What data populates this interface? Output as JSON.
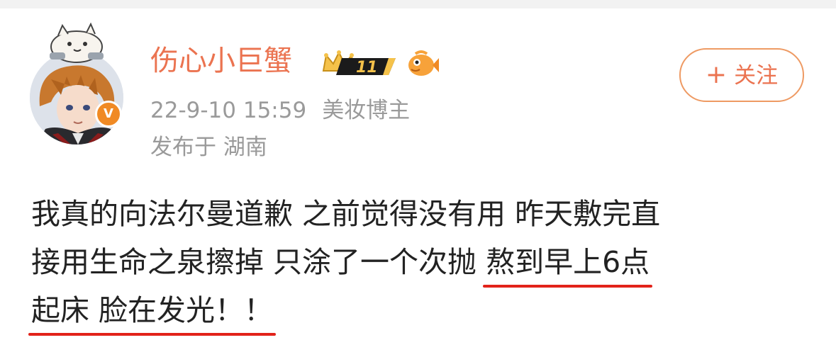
{
  "user": {
    "name": "伤心小巨蟹",
    "badge_level": "11",
    "verified_glyph": "V"
  },
  "meta": {
    "timestamp": "22-9-10 15:59",
    "role": "美妆博主",
    "location": "发布于 湖南"
  },
  "follow_button": {
    "label": "关注",
    "icon": "+"
  },
  "post": {
    "line1": "我真的向法尔曼道歉 之前觉得没有用 昨天敷完直",
    "line2_plain": "接用生命之泉擦掉 只涂了一个次抛 ",
    "line2_underlined": "熬到早上6点",
    "line3_underlined": "起床 脸在发光！！"
  },
  "colors": {
    "username": "#eb7350",
    "meta": "#9a9a9a",
    "follow_border": "#ee9a63",
    "underline": "#e2231a",
    "verified": "#f08a24"
  },
  "icons": [
    "verified-badge-icon",
    "crown-level-badge-icon",
    "fish-fan-badge-icon",
    "plus-icon",
    "cat-sticker-icon"
  ]
}
